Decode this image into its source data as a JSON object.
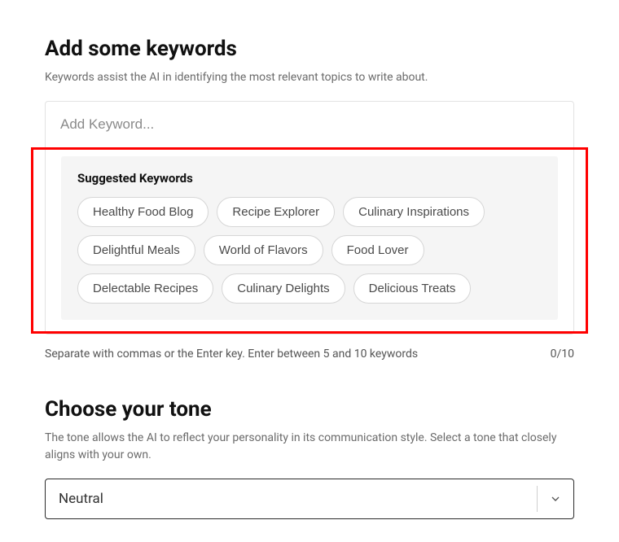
{
  "keywords": {
    "title": "Add some keywords",
    "subtitle": "Keywords assist the AI in identifying the most relevant topics to write about.",
    "input_placeholder": "Add Keyword...",
    "suggested_title": "Suggested Keywords",
    "suggested": [
      "Healthy Food Blog",
      "Recipe Explorer",
      "Culinary Inspirations",
      "Delightful Meals",
      "World of Flavors",
      "Food Lover",
      "Delectable Recipes",
      "Culinary Delights",
      "Delicious Treats"
    ],
    "hint": "Separate with commas or the Enter key. Enter between 5 and 10 keywords",
    "counter": "0/10"
  },
  "tone": {
    "title": "Choose your tone",
    "subtitle": "The tone allows the AI to reflect your personality in its communication style. Select a tone that closely aligns with your own.",
    "selected": "Neutral"
  }
}
